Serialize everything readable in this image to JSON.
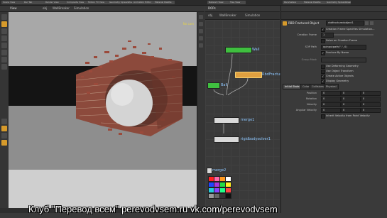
{
  "top_tabs": [
    "Scene View",
    "Rsc Tab",
    "Render View",
    "Composite View",
    "Motion FX View",
    "Geometry Spreadsheet",
    "Animation Editor",
    "Material Palette",
    "Network View",
    "Tree View",
    "Parameters",
    "Material Palette",
    "Geometry Spreadsheet"
  ],
  "left_pane": {
    "view_tab": "View",
    "path_a": "obj",
    "path_b": "WallBreaker",
    "path_c": "Simulation",
    "camera_label": "No cam"
  },
  "node_pane": {
    "tab": "DOPs",
    "path_a": "obj",
    "path_b": "WallBreaker",
    "path_c": "Simulation",
    "nodes": {
      "wall": "Wall",
      "fractured": "RbdFractured",
      "ball": "Ball",
      "merge": "merge1",
      "solver": "rigidbodysolver1",
      "merge2": "merge2"
    }
  },
  "params": {
    "node_type": "RBD Fractured Object",
    "node_name": "rbdfracturedobject1",
    "creation_frame_specifies_sim": "Creation Frame Specifies Simulation...",
    "creation_frame_label": "Creation Frame",
    "creation_frame_value": "1",
    "solve_on_creation": "Solve on Creation Frame",
    "sop_path_label": "SOP Path",
    "sop_path_value": "opinputpath(\".\", 0)",
    "fracture_by_name": "Fracture By Name",
    "group_mask_label": "Group Mask",
    "use_deforming": "Use Deforming Geometry",
    "use_object_transform": "Use Object Transform",
    "create_active": "Create Active Objects",
    "display_geometry": "Display Geometry",
    "tabs": [
      "Initial State",
      "Color",
      "Collisions",
      "Physical"
    ],
    "position_label": "Position",
    "rotation_label": "Rotation",
    "velocity_label": "Velocity",
    "angular_velocity_label": "Angular Velocity",
    "zero": "0",
    "inherit_velocity": "Inherit Velocity from Point Velocity"
  },
  "subtitle": "Клуб \"Перевод всем\"   perevodvsem.ru   vk.com/perevodvsem",
  "colors": {
    "accent": "#d69a2b",
    "wall_node": "#3fbf3f",
    "fractured_node": "#e0a040",
    "ball_node": "#3fbf3f",
    "brick": "#9b4a3b",
    "sphere": "#cfcfcf"
  }
}
